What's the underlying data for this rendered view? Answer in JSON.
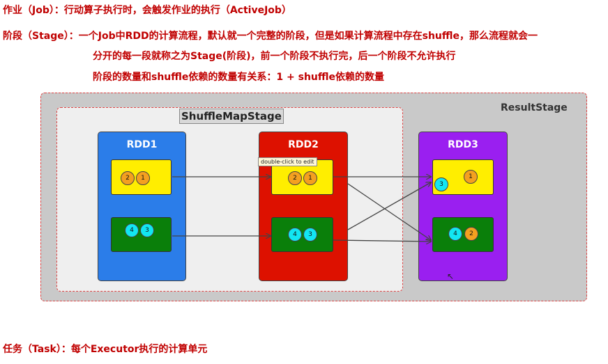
{
  "lines": {
    "job": "作业（Job）：行动算子执行时，会触发作业的执行（ActiveJob）",
    "stage": "阶段（Stage）：一个Job中RDD的计算流程，默认就一个完整的阶段，但是如果计算流程中存在shuffle，那么流程就会一",
    "stage_cont": "分开的每一段就称之为Stage(阶段)，前一个阶段不执行完，后一个阶段不允许执行",
    "stage_count": "阶段的数量和shuffle依赖的数量有关系：1 + shuffle依赖的数量",
    "task": "任务（Task）：每个Executor执行的计算单元"
  },
  "stages": {
    "result": "ResultStage",
    "shuffle_map": "ShuffleMapStage"
  },
  "tooltip": "double-click to edit",
  "rdds": [
    {
      "name": "RDD1",
      "color": "#2b7de9"
    },
    {
      "name": "RDD2",
      "color": "#dd1100"
    },
    {
      "name": "RDD3",
      "color": "#9a1ff0"
    }
  ],
  "partitions": {
    "rdd1_top": [
      "2",
      "1"
    ],
    "rdd1_bottom": [
      "4",
      "3"
    ],
    "rdd2_top": [
      "2",
      "1"
    ],
    "rdd2_bottom": [
      "4",
      "3"
    ],
    "rdd3_top": [
      "3",
      "1"
    ],
    "rdd3_bottom": [
      "4",
      "2"
    ]
  },
  "colors": {
    "text_red": "#c00000",
    "partition_yellow": "#ffee00",
    "partition_green": "#0a7f0a",
    "dot_orange": "#f4a020",
    "dot_cyan": "#12e6f2"
  },
  "icons": {
    "cursor": "mouse-pointer-icon"
  }
}
